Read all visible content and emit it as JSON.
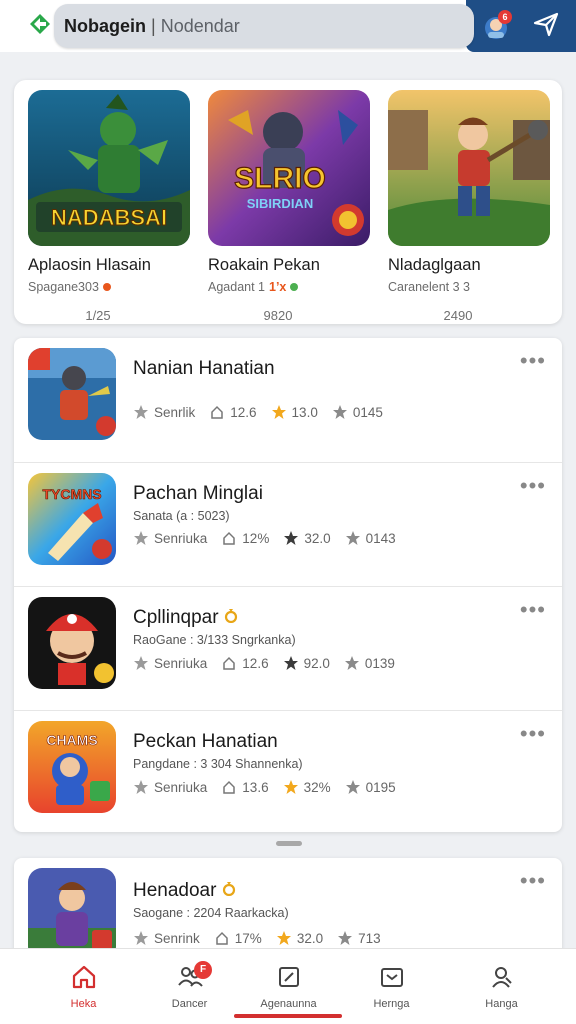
{
  "header": {
    "app_name": "Nobagein",
    "search_placeholder": "Nodendar",
    "avatar_badge": "6"
  },
  "featured": [
    {
      "banner": "NADABSAI",
      "title": "Aplaosin Hlasain",
      "subtitle": "Spagane303",
      "dot_color": "#e8561c",
      "count": "1/25"
    },
    {
      "banner": "SLRIO",
      "banner2": "SIBIRDIAN",
      "title": "Roakain Pekan",
      "subtitle": "Agadant 1",
      "badge": "1’x",
      "dot_color": "#4caf50",
      "count": "9820"
    },
    {
      "banner": "",
      "title": "Nladaglgaan",
      "subtitle": "Caranelent 3 3",
      "dot_color": "",
      "count": "2490"
    }
  ],
  "list": [
    {
      "title": "Nanian Hanatian",
      "subtitle": "",
      "badge": "",
      "stat_label": "Senrlik",
      "stat_saves": "12.6",
      "stat_star_color": "#f2a81d",
      "stat_rating": "13.0",
      "stat_votes": "0145"
    },
    {
      "title": "Pachan Minglai",
      "subtitle": "Sanata (a : 5023)",
      "badge": "",
      "stat_label": "Senriuka",
      "stat_saves": "12%",
      "stat_star_color": "#3b3b3b",
      "stat_rating": "32.0",
      "stat_votes": "0143"
    },
    {
      "title": "Cpllinqpar",
      "subtitle": "RaoGane : 3/133 Sngrkanka)",
      "badge": "ring",
      "stat_label": "Senriuka",
      "stat_saves": "12.6",
      "stat_star_color": "#3b3b3b",
      "stat_rating": "92.0",
      "stat_votes": "0139"
    },
    {
      "title": "Peckan Hanatian",
      "subtitle": "Pangdane : 3 304 Shannenka)",
      "badge": "",
      "stat_label": "Senriuka",
      "stat_saves": "13.6",
      "stat_star_color": "#f2a81d",
      "stat_rating": "32%",
      "stat_votes": "0195"
    }
  ],
  "partial_card": {
    "title": "Henadoar",
    "subtitle": "Saogane : 2204 Raarkacka)",
    "stat_label": "Senrink",
    "stat_saves": "17%",
    "stat_star_color": "#f2a81d",
    "stat_rating": "32.0",
    "stat_votes": "713"
  },
  "icon_banners": {
    "tycoons": "TYCMNS",
    "champs": "CHAMS"
  },
  "nav": [
    {
      "label": "Heka",
      "icon": "home-icon",
      "active": true
    },
    {
      "label": "Dancer",
      "icon": "group-icon",
      "badge": "F"
    },
    {
      "label": "Agenaunna",
      "icon": "edit-icon"
    },
    {
      "label": "Hernga",
      "icon": "inbox-icon"
    },
    {
      "label": "Hanga",
      "icon": "profile-icon"
    }
  ],
  "colors": {
    "accent": "#d32f2f",
    "header_blue": "#1f4e86",
    "logo_green": "#2aa84a"
  }
}
